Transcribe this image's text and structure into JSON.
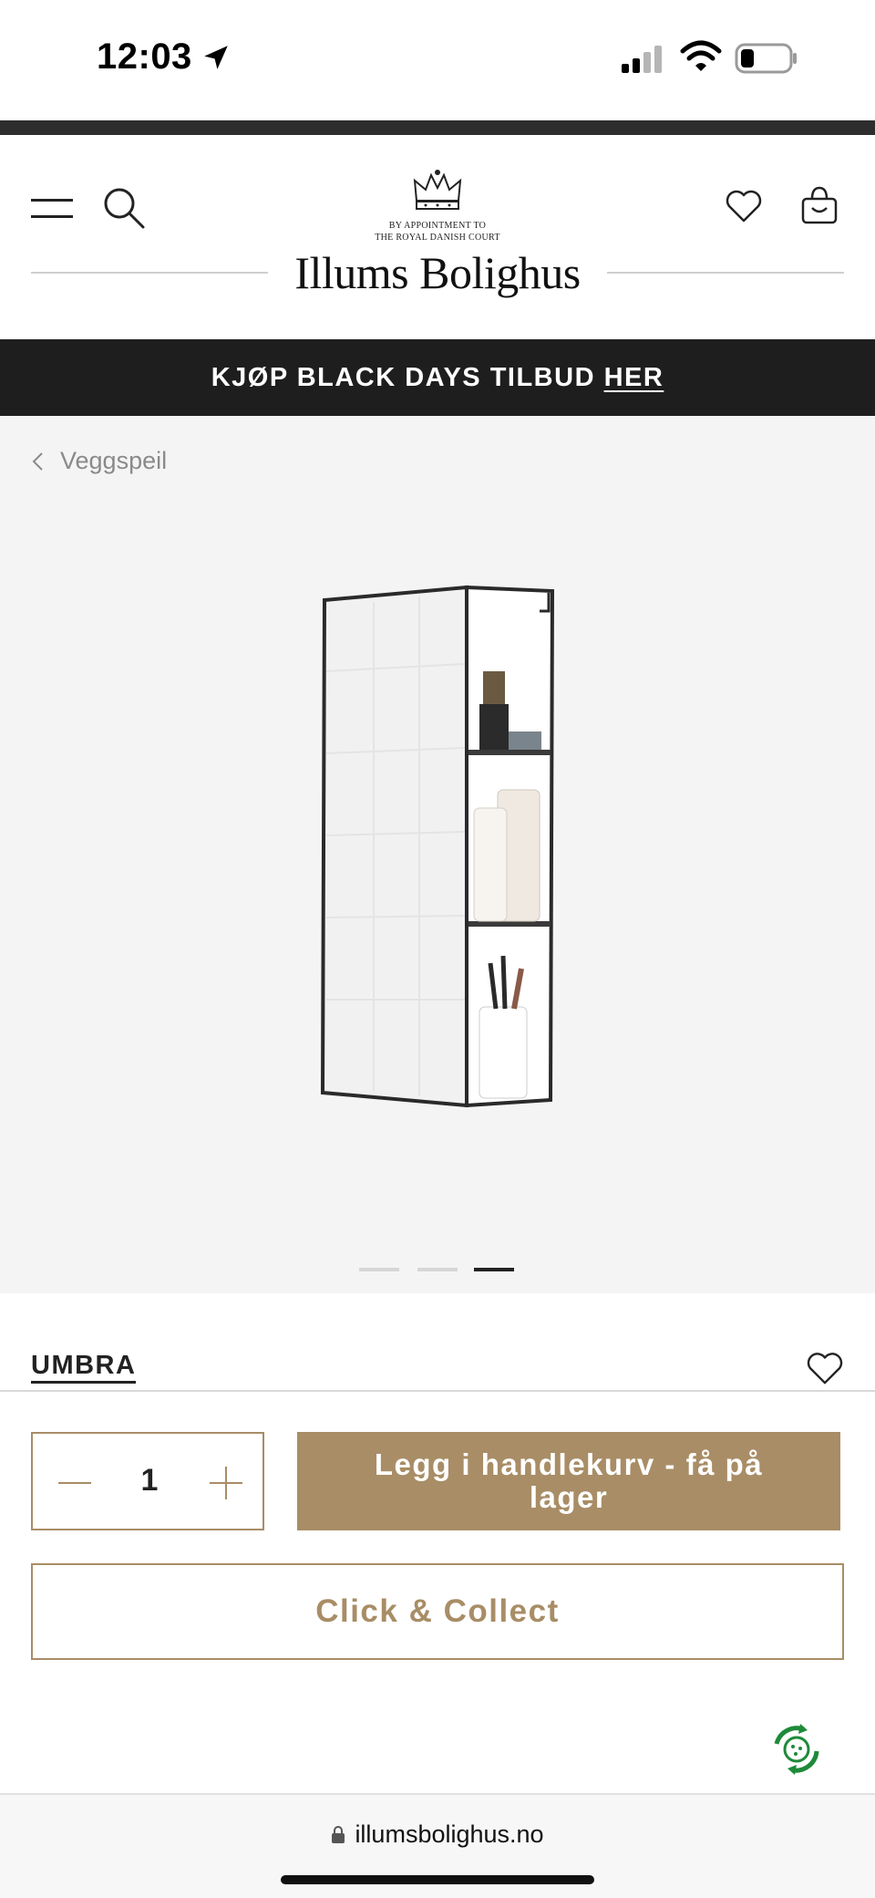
{
  "status_bar": {
    "time": "12:03"
  },
  "header": {
    "appointment_line1": "BY APPOINTMENT TO",
    "appointment_line2": "THE ROYAL DANISH COURT",
    "logo": "Illums Bolighus"
  },
  "promo": {
    "text": "KJØP BLACK DAYS TILBUD",
    "link": "HER"
  },
  "breadcrumb": {
    "label": "Veggspeil"
  },
  "gallery": {
    "image_count": 3,
    "active_index": 2
  },
  "product": {
    "brand": "UMBRA"
  },
  "purchase": {
    "quantity": "1",
    "add_to_cart_label": "Legg i handlekurv - få på lager",
    "click_collect_label": "Click & Collect"
  },
  "browser": {
    "url": "illumsbolighus.no"
  },
  "colors": {
    "accent": "#a88d66",
    "banner": "#1e1e1e",
    "gallery_bg": "#f4f4f4"
  },
  "icons": [
    "location-arrow-icon",
    "signal-icon",
    "wifi-icon",
    "battery-icon",
    "menu-icon",
    "search-icon",
    "heart-icon",
    "bag-icon",
    "crown-icon",
    "chevron-left-icon",
    "minus-icon",
    "plus-icon",
    "recycle-icon",
    "lock-icon"
  ]
}
